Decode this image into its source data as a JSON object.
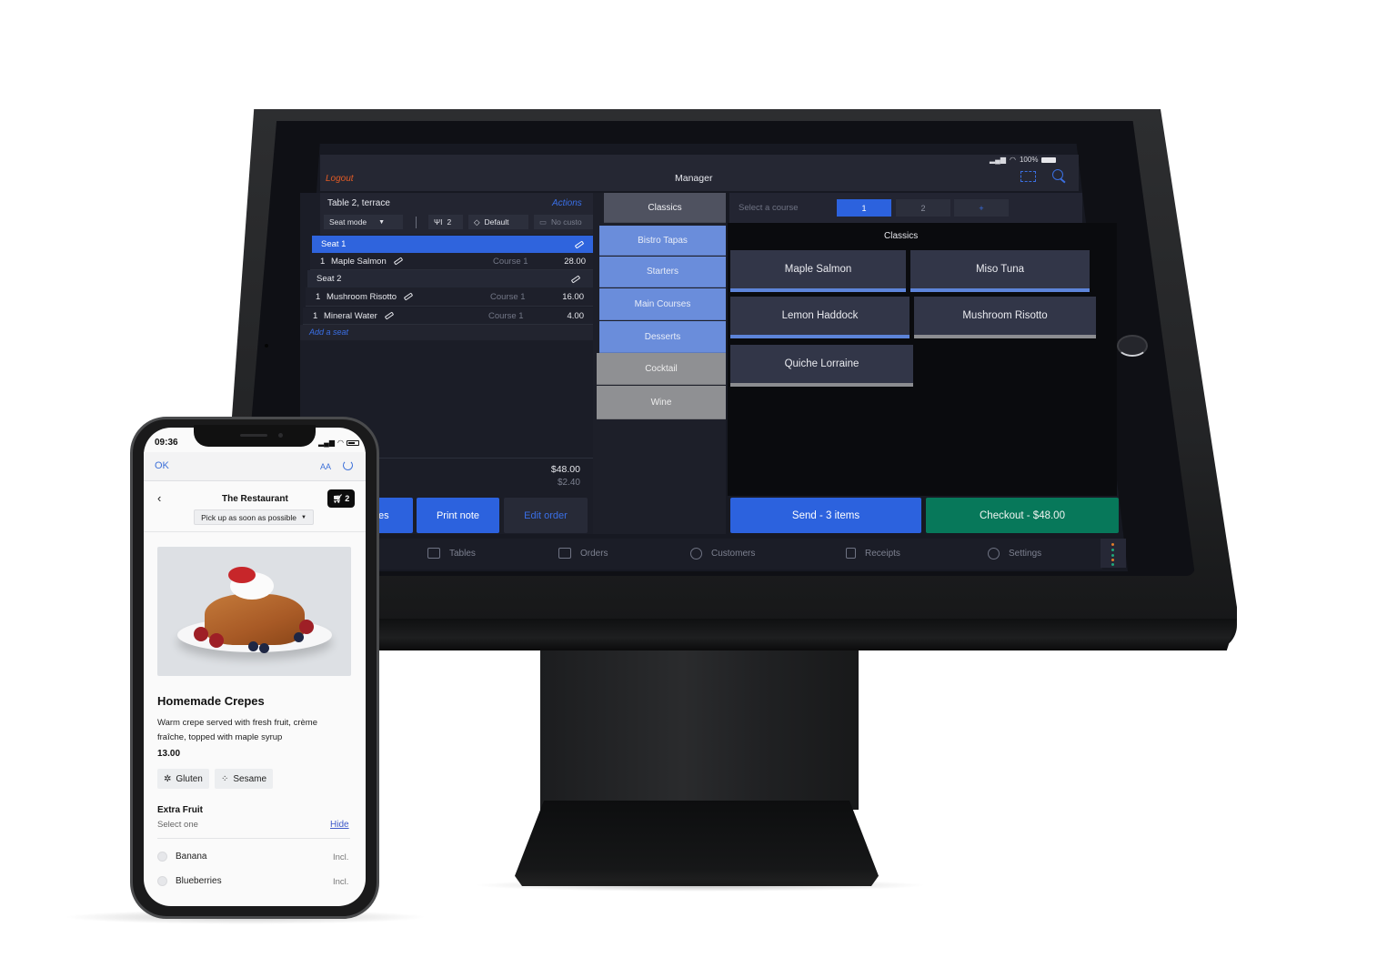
{
  "pos": {
    "status_bar": {
      "signal": "signal-icon",
      "wifi": "wifi-icon",
      "battery_pct": "100%"
    },
    "header": {
      "logout_label": "Logout",
      "title": "Manager",
      "scan_icon": "scan-icon",
      "search_icon": "search-icon"
    },
    "order": {
      "table_title": "Table 2, terrace",
      "actions_label": "Actions",
      "seat_mode_label": "Seat mode",
      "guests_count": "2",
      "price_list_label": "Default",
      "customer_label": "No custo",
      "seats": [
        {
          "label": "Seat 1",
          "active": true,
          "items": [
            {
              "qty": "1",
              "name": "Maple Salmon",
              "course": "Course 1",
              "price": "28.00"
            }
          ]
        },
        {
          "label": "Seat 2",
          "active": false,
          "items": [
            {
              "qty": "1",
              "name": "Mushroom Risotto",
              "course": "Course 1",
              "price": "16.00"
            },
            {
              "qty": "1",
              "name": "Mineral Water",
              "course": "Course 1",
              "price": "4.00"
            }
          ]
        }
      ],
      "add_seat_label": "Add a seat",
      "total": "$48.00",
      "tax": "$2.40"
    },
    "action_buttons": {
      "partial_label": "es",
      "print_note_label": "Print note",
      "edit_order_label": "Edit order"
    },
    "categories": [
      {
        "label": "Classics",
        "state": "selected"
      },
      {
        "label": "Bistro Tapas",
        "state": "blue"
      },
      {
        "label": "Starters",
        "state": "blue"
      },
      {
        "label": "Main Courses",
        "state": "blue"
      },
      {
        "label": "Desserts",
        "state": "blue"
      },
      {
        "label": "Cocktail",
        "state": "gray"
      },
      {
        "label": "Wine",
        "state": "gray"
      }
    ],
    "course_selector": {
      "label": "Select a course",
      "options": [
        "1",
        "2",
        "+"
      ],
      "active": "1"
    },
    "menu": {
      "section_title": "Classics",
      "items": [
        {
          "label": "Maple Salmon",
          "bar": "blue"
        },
        {
          "label": "Miso Tuna",
          "bar": "blue"
        },
        {
          "label": "Lemon Haddock",
          "bar": "blue"
        },
        {
          "label": "Mushroom Risotto",
          "bar": "gray"
        },
        {
          "label": "Quiche Lorraine",
          "bar": "gray"
        }
      ]
    },
    "send_label": "Send - 3 items",
    "checkout_label": "Checkout - $48.00",
    "nav": [
      {
        "label": "Tables",
        "icon": "tables-icon"
      },
      {
        "label": "Orders",
        "icon": "bag-icon"
      },
      {
        "label": "Customers",
        "icon": "user-icon"
      },
      {
        "label": "Receipts",
        "icon": "receipt-icon"
      },
      {
        "label": "Settings",
        "icon": "gear-icon"
      }
    ],
    "colors": {
      "accent_blue": "#2c62de",
      "checkout_green": "#07785a",
      "logout_orange": "#e35b25"
    }
  },
  "phone": {
    "time": "09:36",
    "browser": {
      "ok_label": "OK",
      "text_size_label": "AA"
    },
    "restaurant_name": "The Restaurant",
    "cart_count": "2",
    "pickup_label": "Pick up as soon as possible",
    "product": {
      "name": "Homemade Crepes",
      "description": "Warm crepe served with fresh fruit, crème fraîche, topped with maple syrup",
      "price": "13.00",
      "allergens": [
        "Gluten",
        "Sesame"
      ]
    },
    "modifier": {
      "title": "Extra Fruit",
      "subtitle": "Select one",
      "hide_label": "Hide",
      "options": [
        {
          "label": "Banana",
          "price": "Incl."
        },
        {
          "label": "Blueberries",
          "price": "Incl."
        }
      ]
    }
  }
}
